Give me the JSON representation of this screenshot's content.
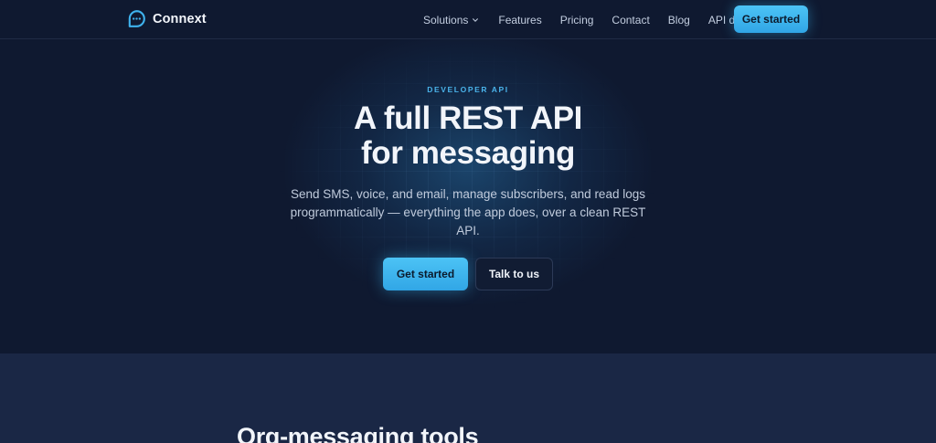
{
  "header": {
    "brand_name": "Connext",
    "brand_icon": "chat-bubble-icon",
    "nav": [
      {
        "label": "Solutions",
        "has_dropdown": true
      },
      {
        "label": "Features"
      },
      {
        "label": "Pricing"
      },
      {
        "label": "Contact"
      },
      {
        "label": "Blog"
      },
      {
        "label": "API docs"
      }
    ],
    "cta_label": "Get started"
  },
  "hero": {
    "eyebrow": "DEVELOPER API",
    "title_line1": "A full REST API",
    "title_line2": "for messaging",
    "subtitle": "Send SMS, voice, and email, manage subscribers, and read logs programmatically — everything the app does, over a clean REST API.",
    "primary_label": "Get started",
    "secondary_label": "Talk to us"
  },
  "section2": {
    "title": "Org-messaging tools"
  },
  "colors": {
    "background": "#0f1930",
    "accent": "#38b6f0",
    "section_bg": "#1a2745"
  }
}
